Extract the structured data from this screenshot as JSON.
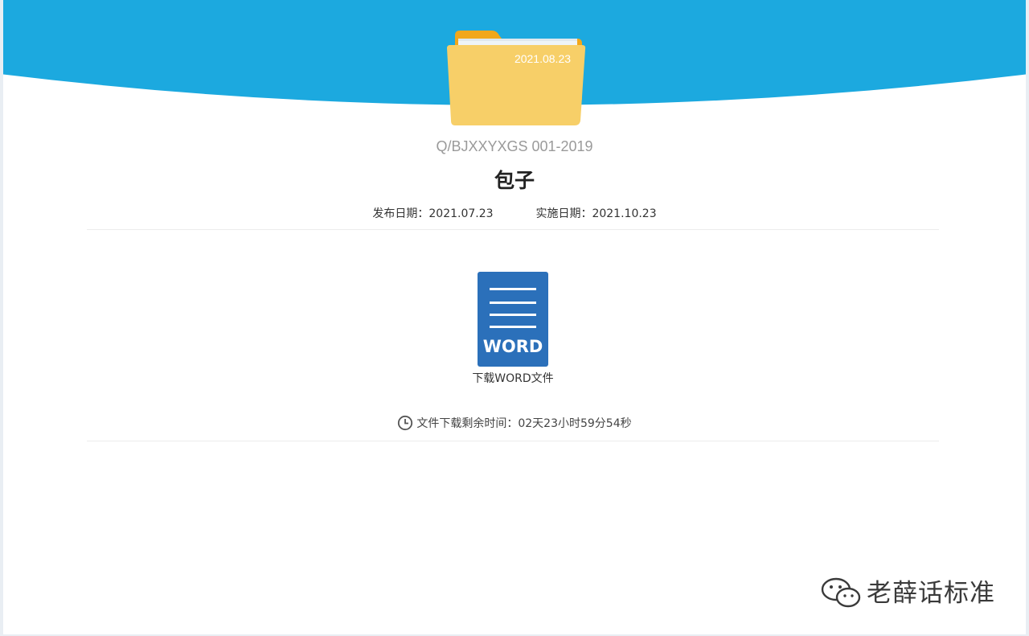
{
  "header": {
    "folder_date": "2021.08.23",
    "colors": {
      "banner": "#1ca9df",
      "folder": "#f7cf68",
      "folder_tab": "#f1a71b"
    }
  },
  "standard": {
    "code": "Q/BJXXYXGS 001-2019",
    "title": "包子",
    "publish_label": "发布日期：",
    "publish_date": "2021.07.23",
    "implement_label": "实施日期：",
    "implement_date": "2021.10.23"
  },
  "download": {
    "icon": "word-document-icon",
    "icon_text": "WORD",
    "label": "下载WORD文件",
    "colors": {
      "icon": "#2b70ba"
    }
  },
  "countdown": {
    "icon": "clock-icon",
    "label": "文件下载剩余时间：",
    "value": "02天23小时59分54秒"
  },
  "watermark": {
    "icon": "wechat-icon",
    "text": "老薛话标准"
  }
}
